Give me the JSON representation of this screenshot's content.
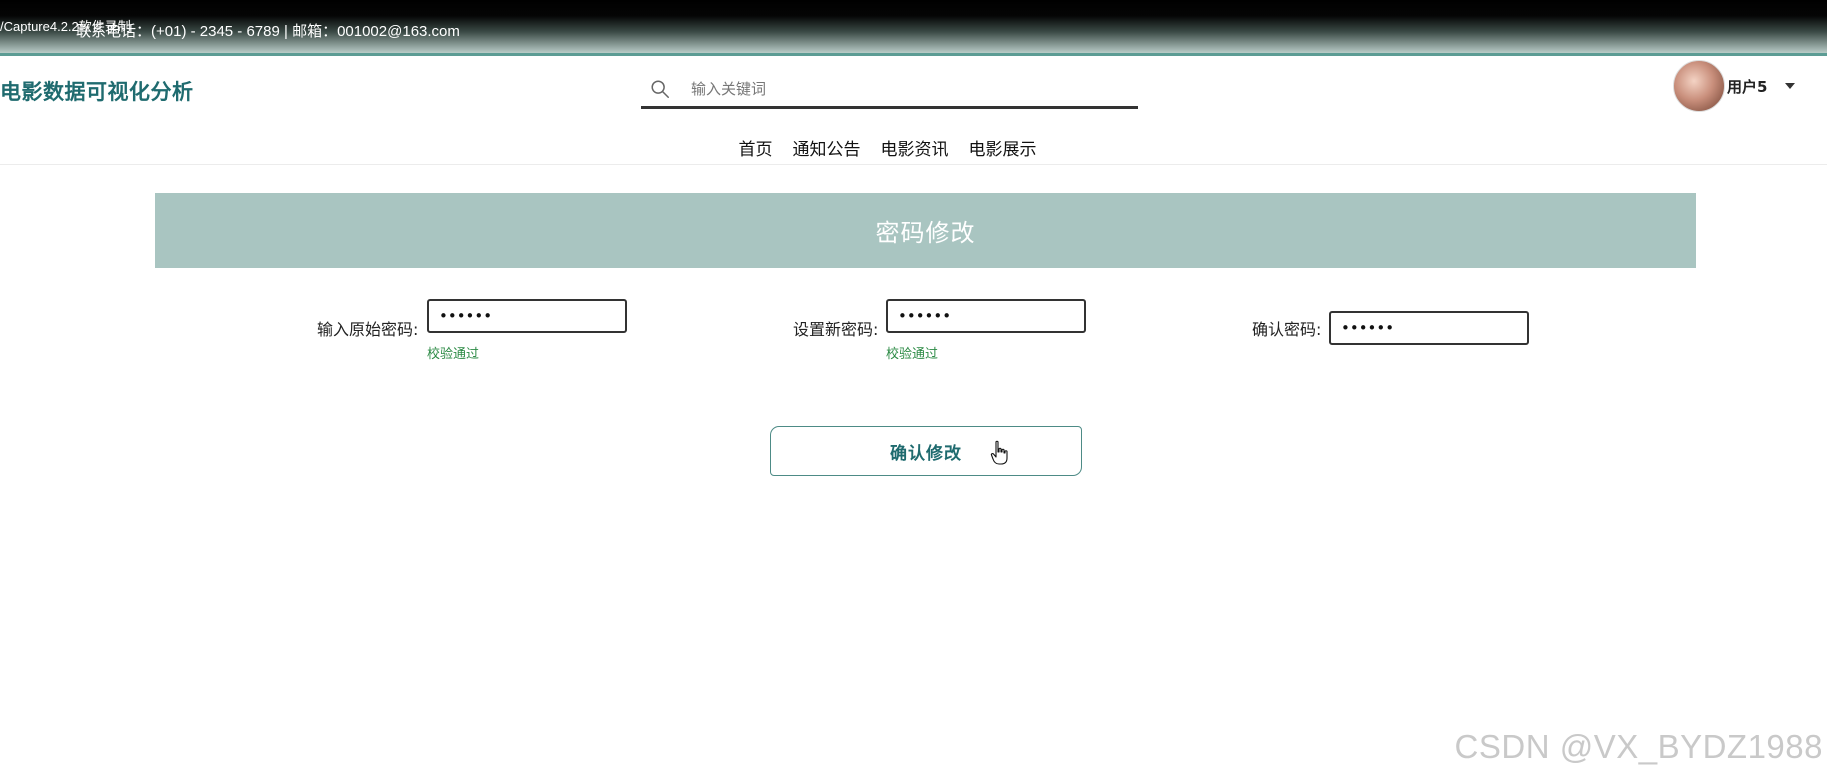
{
  "topbar": {
    "capture_label": "/Capture4.2.2软件录制",
    "contact": "联系电话：(+01) - 2345 - 6789 | 邮箱：001002@163.com"
  },
  "header": {
    "brand": "电影数据可视化分析",
    "search_placeholder": "输入关键词",
    "username": "用户5"
  },
  "nav": {
    "items": [
      "首页",
      "通知公告",
      "电影资讯",
      "电影展示"
    ]
  },
  "banner": {
    "title": "密码修改"
  },
  "form": {
    "old_password": {
      "label": "输入原始密码:",
      "value": "••••••",
      "hint": "校验通过"
    },
    "new_password": {
      "label": "设置新密码:",
      "value": "••••••",
      "hint": "校验通过"
    },
    "confirm_password": {
      "label": "确认密码:",
      "value": "••••••"
    },
    "submit_label": "确认修改"
  },
  "watermark": "CSDN @VX_BYDZ1988",
  "colors": {
    "brand": "#1f6b6f",
    "banner": "#a9c5c1",
    "hint": "#2b8a44"
  }
}
